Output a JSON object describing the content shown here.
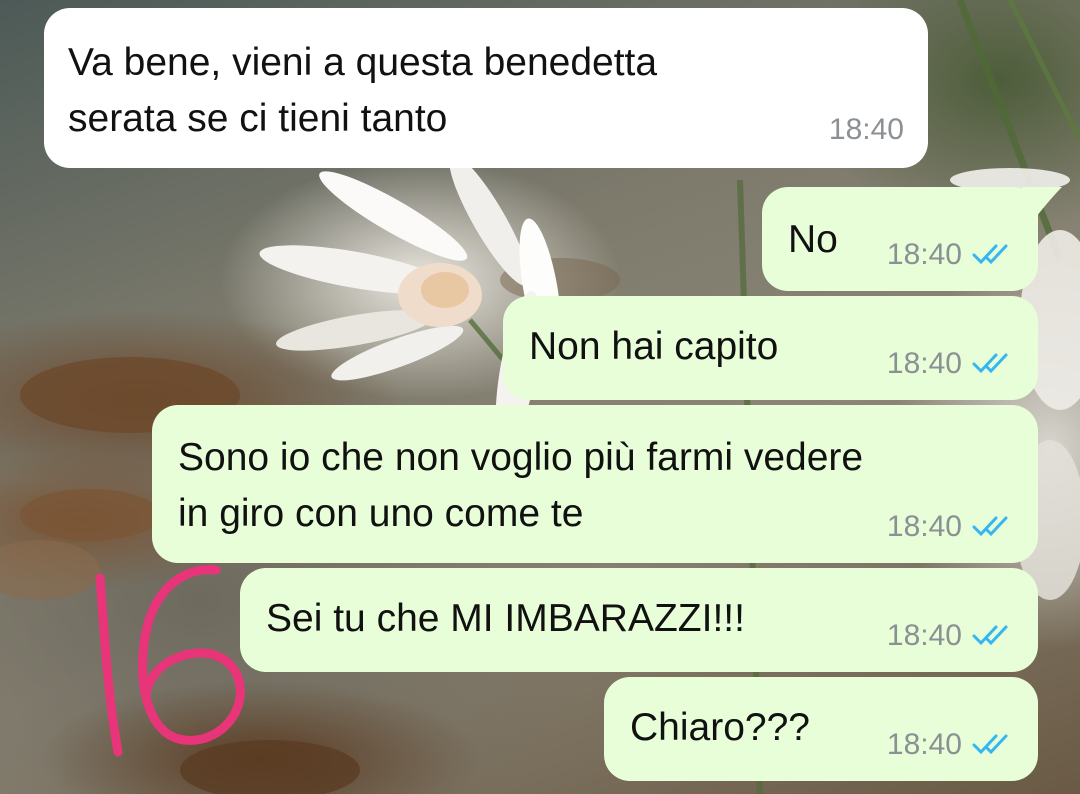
{
  "messages": [
    {
      "direction": "incoming",
      "text_lines": [
        "Va bene, vieni a questa benedetta",
        "serata se ci tieni tanto"
      ],
      "time": "18:40"
    },
    {
      "direction": "outgoing",
      "text_lines": [
        "No"
      ],
      "time": "18:40",
      "status": "read"
    },
    {
      "direction": "outgoing",
      "text_lines": [
        "Non hai capito"
      ],
      "time": "18:40",
      "status": "read"
    },
    {
      "direction": "outgoing",
      "text_lines": [
        "Sono io che non voglio più farmi vedere",
        "in giro con uno come te"
      ],
      "time": "18:40",
      "status": "read"
    },
    {
      "direction": "outgoing",
      "text_lines": [
        "Sei tu che MI IMBARAZZI!!!"
      ],
      "time": "18:40",
      "status": "read"
    },
    {
      "direction": "outgoing",
      "text_lines": [
        "Chiaro???"
      ],
      "time": "18:40",
      "status": "read"
    }
  ],
  "handwritten_annotation": "16",
  "colors": {
    "incoming_bubble": "#ffffff",
    "outgoing_bubble": "#e7fed8",
    "read_ticks": "#34b7f1",
    "timestamp": "#8a9093",
    "annotation_ink": "#e8357a"
  },
  "icons": {
    "read_status": "double-check-icon"
  }
}
